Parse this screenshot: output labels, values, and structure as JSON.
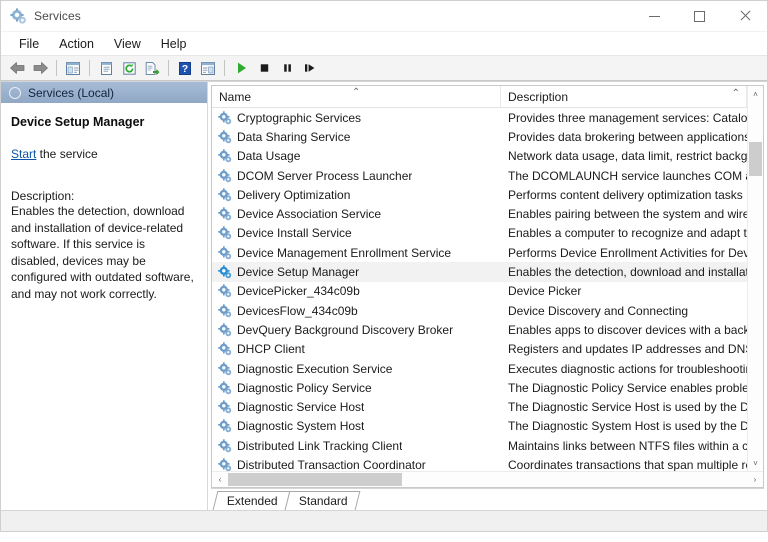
{
  "window": {
    "title": "Services",
    "icon": "services-gear-icon",
    "controls": {
      "minimize": "Minimize",
      "maximize": "Maximize",
      "close": "Close"
    }
  },
  "menubar": {
    "items": [
      {
        "label": "File"
      },
      {
        "label": "Action"
      },
      {
        "label": "View"
      },
      {
        "label": "Help"
      }
    ]
  },
  "toolbar": {
    "buttons": [
      {
        "name": "back-icon",
        "title": "Back"
      },
      {
        "name": "forward-icon",
        "title": "Forward"
      },
      {
        "name": "show-hide-console-tree-icon",
        "title": "Show/Hide Console Tree"
      },
      {
        "name": "properties-icon",
        "title": "Properties"
      },
      {
        "name": "refresh-icon",
        "title": "Refresh"
      },
      {
        "name": "export-list-icon",
        "title": "Export List"
      },
      {
        "name": "help-icon",
        "title": "Help"
      },
      {
        "name": "show-hide-action-pane-icon",
        "title": "Show/Hide Action Pane"
      },
      {
        "name": "start-service-icon",
        "title": "Start Service"
      },
      {
        "name": "stop-service-icon",
        "title": "Stop Service"
      },
      {
        "name": "pause-service-icon",
        "title": "Pause Service"
      },
      {
        "name": "restart-service-icon",
        "title": "Restart Service"
      }
    ]
  },
  "left_pane": {
    "header": "Services (Local)",
    "service_title": "Device Setup Manager",
    "action_link": "Start",
    "action_suffix": " the service",
    "description_label": "Description:",
    "description_text": "Enables the detection, download and installation of device-related software. If this service is disabled, devices may be configured with outdated software, and may not work correctly."
  },
  "list": {
    "columns": [
      {
        "key": "name",
        "label": "Name",
        "sorted": "asc"
      },
      {
        "key": "description",
        "label": "Description",
        "sorted": "none"
      }
    ],
    "selected_index": 8,
    "rows": [
      {
        "name": "Cryptographic Services",
        "description": "Provides three management services: Catalog Da"
      },
      {
        "name": "Data Sharing Service",
        "description": "Provides data brokering between applications."
      },
      {
        "name": "Data Usage",
        "description": "Network data usage, data limit, restrict backgrou"
      },
      {
        "name": "DCOM Server Process Launcher",
        "description": "The DCOMLAUNCH service launches COM and"
      },
      {
        "name": "Delivery Optimization",
        "description": "Performs content delivery optimization tasks"
      },
      {
        "name": "Device Association Service",
        "description": "Enables pairing between the system and wired o"
      },
      {
        "name": "Device Install Service",
        "description": "Enables a computer to recognize and adapt to h"
      },
      {
        "name": "Device Management Enrollment Service",
        "description": "Performs Device Enrollment Activities for Device"
      },
      {
        "name": "Device Setup Manager",
        "description": "Enables the detection, download and installation"
      },
      {
        "name": "DevicePicker_434c09b",
        "description": "Device Picker"
      },
      {
        "name": "DevicesFlow_434c09b",
        "description": "Device Discovery and Connecting"
      },
      {
        "name": "DevQuery Background Discovery Broker",
        "description": "Enables apps to discover devices with a backgro"
      },
      {
        "name": "DHCP Client",
        "description": "Registers and updates IP addresses and DNS reco"
      },
      {
        "name": "Diagnostic Execution Service",
        "description": "Executes diagnostic actions for troubleshooting"
      },
      {
        "name": "Diagnostic Policy Service",
        "description": "The Diagnostic Policy Service enables problem c"
      },
      {
        "name": "Diagnostic Service Host",
        "description": "The Diagnostic Service Host is used by the Diagn"
      },
      {
        "name": "Diagnostic System Host",
        "description": "The Diagnostic System Host is used by the Diagn"
      },
      {
        "name": "Distributed Link Tracking Client",
        "description": "Maintains links between NTFS files within a com"
      },
      {
        "name": "Distributed Transaction Coordinator",
        "description": "Coordinates transactions that span multiple reso"
      }
    ]
  },
  "scrollbars": {
    "vertical": {
      "up_arrow": "˄",
      "down_arrow": "˅"
    },
    "horizontal": {
      "left_arrow": "‹",
      "right_arrow": "›"
    }
  },
  "tabs": [
    {
      "label": "Extended",
      "active": false
    },
    {
      "label": "Standard",
      "active": true
    }
  ],
  "colors": {
    "pane_header_start": "#a7bcd6",
    "pane_header_end": "#90a8c6",
    "link": "#0a55a8",
    "selection": "#f2f2f2",
    "service_icon": "#6f9ecb",
    "service_icon_selected": "#2a8fd4",
    "start_green": "#2eac2e",
    "stop_black": "#1b1b1b",
    "help_blue": "#1d52b0"
  }
}
